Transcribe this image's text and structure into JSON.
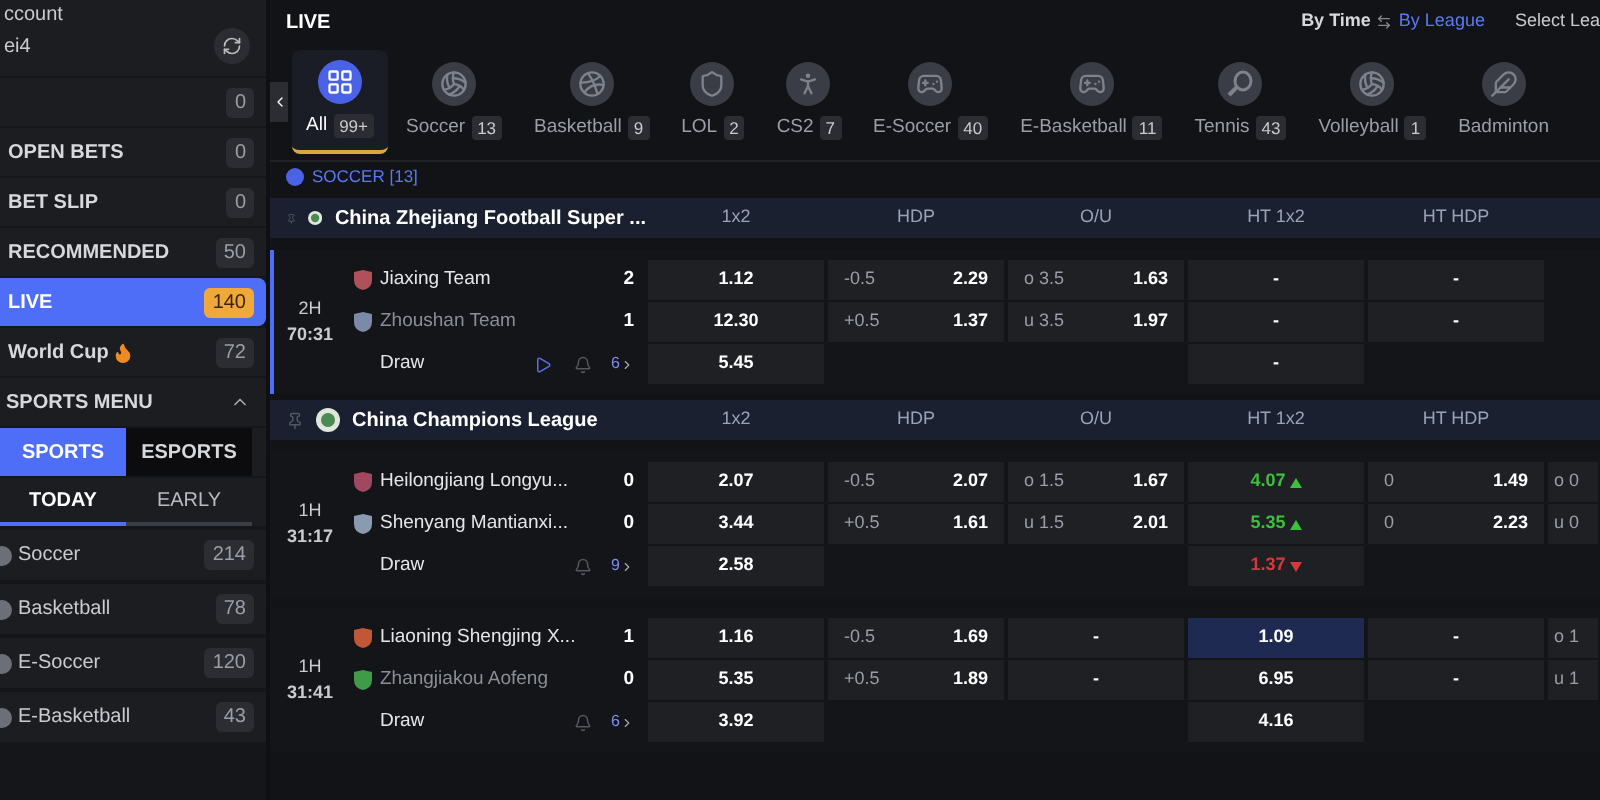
{
  "sidebar": {
    "account_label": "ccount",
    "account_name": "ei4",
    "items": [
      {
        "badge": "0",
        "selected": false
      },
      {
        "label": "OPEN BETS",
        "badge": "0",
        "selected": false
      },
      {
        "label": "BET SLIP",
        "badge": "0",
        "selected": false
      },
      {
        "label": "RECOMMENDED",
        "badge": "50",
        "selected": false
      },
      {
        "label": "LIVE",
        "badge": "140",
        "selected": true
      },
      {
        "label": "World Cup",
        "badge": "72",
        "selected": false,
        "flame": true
      }
    ],
    "sports_menu": {
      "title": "SPORTS MENU",
      "expanded": true
    },
    "type_tabs": [
      {
        "label": "SPORTS",
        "selected": true
      },
      {
        "label": "ESPORTS",
        "selected": false
      }
    ],
    "day_tabs": [
      {
        "label": "TODAY",
        "selected": true
      },
      {
        "label": "EARLY",
        "selected": false
      }
    ],
    "sports": [
      {
        "name": "Soccer",
        "count": "214"
      },
      {
        "name": "Basketball",
        "count": "78"
      },
      {
        "name": "E-Soccer",
        "count": "120"
      },
      {
        "name": "E-Basketball",
        "count": "43"
      }
    ]
  },
  "main": {
    "title": "LIVE",
    "sort": {
      "by_time": "By Time",
      "by_league": "By League",
      "select": "Select Lea"
    },
    "sport_tabs": [
      {
        "kind": "all",
        "label": "All",
        "count": "99+",
        "selected": true
      },
      {
        "kind": "soccer",
        "label": "Soccer",
        "count": "13",
        "selected": false
      },
      {
        "kind": "basketball",
        "label": "Basketball",
        "count": "9",
        "selected": false
      },
      {
        "kind": "lol",
        "label": "LOL",
        "count": "2",
        "selected": false
      },
      {
        "kind": "cs",
        "label": "CS2",
        "count": "7",
        "selected": false
      },
      {
        "kind": "esport",
        "label": "E-Soccer",
        "count": "40",
        "selected": false
      },
      {
        "kind": "esport",
        "label": "E-Basketball",
        "count": "11",
        "selected": false
      },
      {
        "kind": "tennis",
        "label": "Tennis",
        "count": "43",
        "selected": false
      },
      {
        "kind": "volleyball",
        "label": "Volleyball",
        "count": "1",
        "selected": false
      },
      {
        "kind": "badminton",
        "label": "Badminton",
        "selected": false
      }
    ],
    "section": "SOCCER [13]",
    "leagues": [
      {
        "name": "China Zhejiang Football Super ...",
        "columns": [
          "1x2",
          "HDP",
          "O/U",
          "HT 1x2",
          "HT HDP"
        ],
        "matches": [
          {
            "period": "2H",
            "clock": "70:31",
            "selected": true,
            "draw": "Draw",
            "video": true,
            "count": "6",
            "teams": [
              {
                "name": "Jiaxing Team",
                "score": "2",
                "dimmed": false,
                "color": "#b0505a"
              },
              {
                "name": "Zhoushan Team",
                "score": "1",
                "dimmed": true,
                "color": "#7a8aa8"
              }
            ],
            "markets": [
              {
                "cells": [
                  {
                    "odds": "1.12",
                    "selected": false
                  },
                  {
                    "odds": "12.30",
                    "selected": false
                  },
                  {
                    "odds": "5.45",
                    "selected": false
                  }
                ]
              },
              {
                "cells": [
                  {
                    "line": "-0.5",
                    "odds": "2.29",
                    "selected": false
                  },
                  {
                    "line": "+0.5",
                    "odds": "1.37",
                    "selected": false
                  }
                ]
              },
              {
                "cells": [
                  {
                    "line": "o 3.5",
                    "odds": "1.63",
                    "selected": false
                  },
                  {
                    "line": "u 3.5",
                    "odds": "1.97",
                    "selected": false
                  }
                ]
              },
              {
                "cells": [
                  {
                    "odds": "-",
                    "selected": false
                  },
                  {
                    "odds": "-",
                    "selected": false
                  },
                  {
                    "odds": "-",
                    "selected": false
                  }
                ]
              },
              {
                "cells": [
                  {
                    "odds": "-",
                    "selected": false
                  },
                  {
                    "odds": "-",
                    "selected": false
                  }
                ]
              }
            ]
          }
        ]
      },
      {
        "name": "China Champions League",
        "columns": [
          "1x2",
          "HDP",
          "O/U",
          "HT 1x2",
          "HT HDP"
        ],
        "matches": [
          {
            "period": "1H",
            "clock": "31:17",
            "selected": false,
            "draw": "Draw",
            "video": false,
            "count": "9",
            "teams": [
              {
                "name": "Heilongjiang Longyu...",
                "score": "0",
                "dimmed": false,
                "color": "#a04860"
              },
              {
                "name": "Shenyang Mantianxi...",
                "score": "0",
                "dimmed": false,
                "color": "#8a9ab0"
              }
            ],
            "markets": [
              {
                "cells": [
                  {
                    "odds": "2.07",
                    "selected": false
                  },
                  {
                    "odds": "3.44",
                    "selected": false
                  },
                  {
                    "odds": "2.58",
                    "selected": false
                  }
                ]
              },
              {
                "cells": [
                  {
                    "line": "-0.5",
                    "odds": "2.07",
                    "selected": false
                  },
                  {
                    "line": "+0.5",
                    "odds": "1.61",
                    "selected": false
                  }
                ]
              },
              {
                "cells": [
                  {
                    "line": "o 1.5",
                    "odds": "1.67",
                    "selected": false
                  },
                  {
                    "line": "u 1.5",
                    "odds": "2.01",
                    "selected": false
                  }
                ]
              },
              {
                "cells": [
                  {
                    "odds": "4.07",
                    "rising": true,
                    "selected": false
                  },
                  {
                    "odds": "5.35",
                    "rising": true,
                    "selected": false
                  },
                  {
                    "odds": "1.37",
                    "rising": false,
                    "selected": false
                  }
                ]
              },
              {
                "cells": [
                  {
                    "line": "0",
                    "odds": "1.49",
                    "selected": false
                  },
                  {
                    "line": "0",
                    "odds": "2.23",
                    "selected": false
                  }
                ]
              },
              {
                "cells": [
                  {
                    "line": "o 0",
                    "selected": false
                  },
                  {
                    "line": "u 0",
                    "selected": false
                  }
                ]
              }
            ]
          },
          {
            "period": "1H",
            "clock": "31:41",
            "selected": false,
            "draw": "Draw",
            "video": false,
            "count": "6",
            "teams": [
              {
                "name": "Liaoning Shengjing X...",
                "score": "1",
                "dimmed": false,
                "color": "#c05838"
              },
              {
                "name": "Zhangjiakou Aofeng",
                "score": "0",
                "dimmed": true,
                "color": "#3f9a4a"
              }
            ],
            "markets": [
              {
                "cells": [
                  {
                    "odds": "1.16",
                    "selected": false
                  },
                  {
                    "odds": "5.35",
                    "selected": false
                  },
                  {
                    "odds": "3.92",
                    "selected": false
                  }
                ]
              },
              {
                "cells": [
                  {
                    "line": "-0.5",
                    "odds": "1.69",
                    "selected": false
                  },
                  {
                    "line": "+0.5",
                    "odds": "1.89",
                    "selected": false
                  }
                ]
              },
              {
                "cells": [
                  {
                    "odds": "-",
                    "selected": false
                  },
                  {
                    "odds": "-",
                    "selected": false
                  }
                ]
              },
              {
                "cells": [
                  {
                    "odds": "1.09",
                    "selected": true
                  },
                  {
                    "odds": "6.95",
                    "selected": false
                  },
                  {
                    "odds": "4.16",
                    "selected": false
                  }
                ]
              },
              {
                "cells": [
                  {
                    "odds": "-",
                    "selected": false
                  },
                  {
                    "odds": "-",
                    "selected": false
                  }
                ]
              },
              {
                "cells": [
                  {
                    "line": "o 1",
                    "selected": false
                  },
                  {
                    "line": "u 1",
                    "selected": false
                  }
                ]
              }
            ]
          }
        ]
      }
    ]
  }
}
